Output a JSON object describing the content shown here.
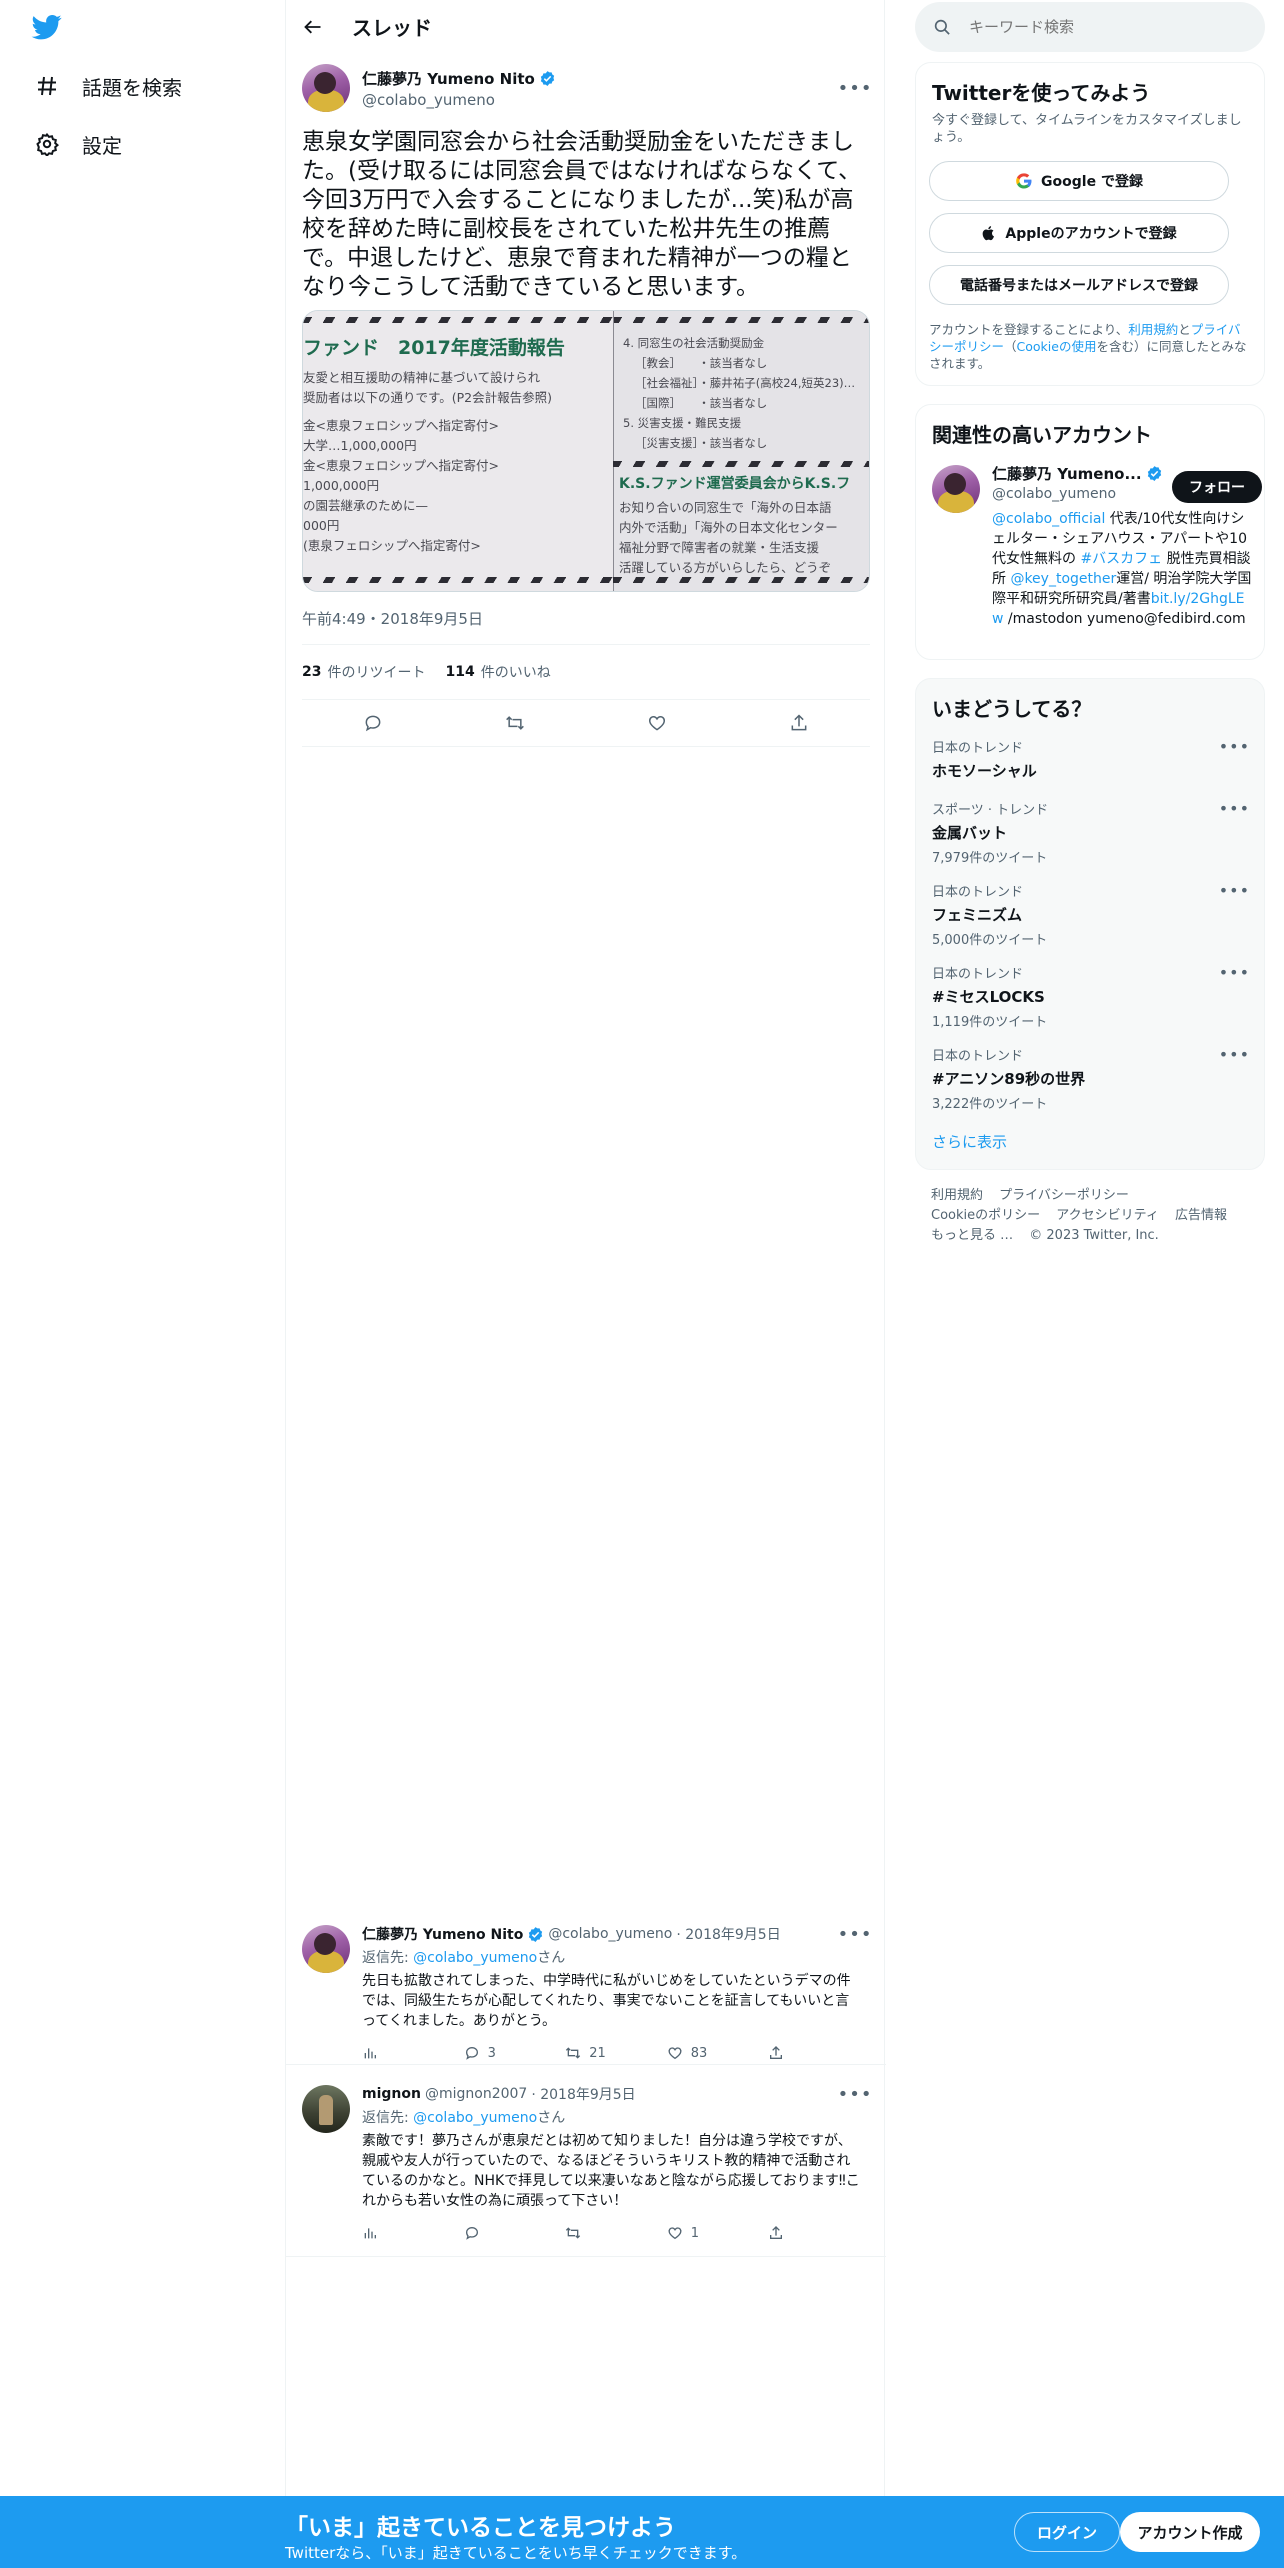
{
  "nav": {
    "explore_label": "話題を検索",
    "settings_label": "設定"
  },
  "header": {
    "title": "スレッド"
  },
  "main_tweet": {
    "name": "仁藤夢乃 Yumeno Nito",
    "handle": "@colabo_yumeno",
    "text": "恵泉女学園同窓会から社会活動奨励金をいただきました。(受け取るには同窓会員ではなければならなくて、今回3万円で入会することになりましたが...笑)私が高校を辞めた時に副校長をされていた松井先生の推薦で。中退したけど、恵泉で育まれた精神が一つの糧となり今こうして活動できていると思います。",
    "timestamp": "午前4:49・2018年9月5日",
    "retweets": "23",
    "retweets_label": "件のリツイート",
    "likes": "114",
    "likes_label": "件のいいね"
  },
  "tweet_image": {
    "heading": "ファンド　2017年度活動報告",
    "left_lines": [
      "友愛と相互援助の精神に基づいて設けられ",
      "奨励者は以下の通りです。(P2会計報告参照)",
      "金<恵泉フェロシップへ指定寄付>",
      "大学…1,000,000円",
      "金<恵泉フェロシップへ指定寄付>",
      "1,000,000円",
      "の園芸継承のために—",
      "000円",
      "(恵泉フェロシップへ指定寄付>"
    ],
    "right_lines": [
      "4. 同窓生の社会活動奨励金",
      "［教会］　　・該当者なし",
      "［社会福祉］・藤井祐子(高校24,短英23)…",
      "［国際］　　・該当者なし",
      "5. 災害支援・難民支援",
      "［災害支援］・該当者なし"
    ],
    "right_heading": "K.S.ファンド運営委員会からK.S.フ",
    "right_lines_2": [
      "お知り合いの同窓生で「海外の日本語",
      "内外で活動」「海外の日本文化センター",
      "福祉分野で障害者の就業・生活支援",
      "活躍している方がいらしたら、どうぞ"
    ]
  },
  "replies": [
    {
      "name": "仁藤夢乃 Yumeno Nito",
      "handle": "@colabo_yumeno",
      "date": "· 2018年9月5日",
      "reply_to_prefix": "返信先:",
      "reply_to_handle": "@colabo_yumeno",
      "reply_to_suffix": "さん",
      "text": "先日も拡散されてしまった、中学時代に私がいじめをしていたというデマの件では、同級生たちが心配してくれたり、事実でないことを証言してもいいと言ってくれました。ありがとう。",
      "replies_count": "3",
      "retweets_count": "21",
      "likes_count": "83"
    },
    {
      "name": "mignon",
      "handle": "@mignon2007",
      "date": "· 2018年9月5日",
      "reply_to_prefix": "返信先:",
      "reply_to_handle": "@colabo_yumeno",
      "reply_to_suffix": "さん",
      "text": "素敵です！夢乃さんが恵泉だとは初めて知りました！自分は違う学校ですが、親戚や友人が行っていたので、なるほどそういうキリスト教的精神で活動されているのかなと。NHKで拝見して以来凄いなあと陰ながら応援しております‼︎これからも若い女性の為に頑張って下さい！",
      "replies_count": "",
      "retweets_count": "",
      "likes_count": "1"
    }
  ],
  "search": {
    "placeholder": "キーワード検索"
  },
  "signup": {
    "title": "Twitterを使ってみよう",
    "subtitle": "今すぐ登録して、タイムラインをカスタマイズしましょう。",
    "google_label": "Google で登録",
    "apple_label": "Appleのアカウントで登録",
    "phone_label": "電話番号またはメールアドレスで登録",
    "legal_1": "アカウントを登録することにより、",
    "legal_terms": "利用規約",
    "legal_2": "と",
    "legal_privacy": "プライバシーポリシー",
    "legal_3": "（",
    "legal_cookie": "Cookieの使用",
    "legal_4": "を含む）に同意したとみなされます。"
  },
  "related": {
    "title": "関連性の高いアカウント",
    "name": "仁藤夢乃 Yumeno...",
    "handle": "@colabo_yumeno",
    "follow_label": "フォロー",
    "bio_link1": "@colabo_official",
    "bio_1": " 代表/10代女性向けシェルター・シェアハウス・アパートや10代女性無料の ",
    "bio_link2": "#バスカフェ",
    "bio_2": " 脱性売買相談所 ",
    "bio_link3": "@key_together",
    "bio_3": "運営/ 明治学院大学国際平和研究所研究員/著書",
    "bio_link4": "bit.ly/2GhgLEw",
    "bio_4": " /mastodon yumeno@fedibird.com"
  },
  "trends": {
    "title": "いまどうしてる？",
    "items": [
      {
        "meta": "日本のトレンド",
        "name": "ホモソーシャル",
        "count": ""
      },
      {
        "meta": "スポーツ · トレンド",
        "name": "金属バット",
        "count": "7,979件のツイート"
      },
      {
        "meta": "日本のトレンド",
        "name": "フェミニズム",
        "count": "5,000件のツイート"
      },
      {
        "meta": "日本のトレンド",
        "name": "#ミセスLOCKS",
        "count": "1,119件のツイート"
      },
      {
        "meta": "日本のトレンド",
        "name": "#アニソン89秒の世界",
        "count": "3,222件のツイート"
      }
    ],
    "show_more": "さらに表示"
  },
  "footer": {
    "terms": "利用規約",
    "privacy": "プライバシーポリシー",
    "cookie": "Cookieのポリシー",
    "accessibility": "アクセシビリティ",
    "ads": "広告情報",
    "more": "もっと見る …",
    "copyright": "© 2023 Twitter, Inc."
  },
  "bottom_bar": {
    "title": "「いま」起きていることを見つけよう",
    "subtitle": "Twitterなら、「いま」起きていることをいち早くチェックできます。",
    "login_label": "ログイン",
    "signup_label": "アカウント作成"
  },
  "colors": {
    "accent": "#1d9bf0",
    "text": "#0f1419",
    "muted": "#536471",
    "border": "#eff3f4"
  }
}
